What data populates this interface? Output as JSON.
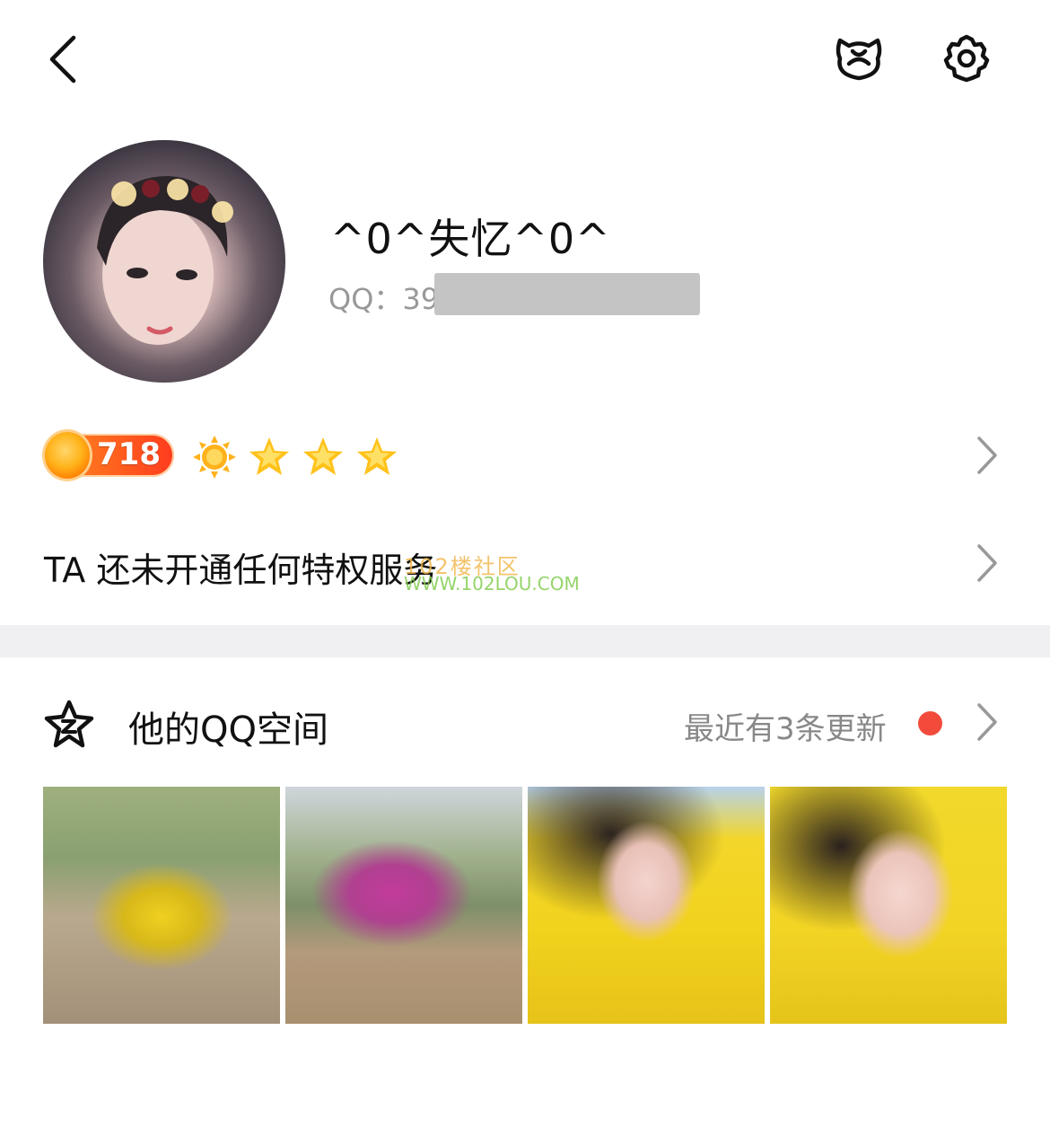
{
  "header": {
    "back_icon": "chevron-left-icon",
    "pet_icon": "pet-bear-icon",
    "settings_icon": "gear-icon"
  },
  "profile": {
    "nickname": "^0^失忆^0^",
    "qq_label": "QQ：",
    "qq_visible": "39"
  },
  "level": {
    "value": "718",
    "icons": [
      "sun-icon",
      "star-icon",
      "star-icon",
      "star-icon"
    ],
    "colors": {
      "badge_start": "#ff8f1f",
      "badge_end": "#ff3b1e",
      "star": "#ffc21a"
    }
  },
  "privilege": {
    "text": "TA 还未开通任何特权服务",
    "watermark_line1": "102楼社区",
    "watermark_line2": "WWW.102LOU.COM"
  },
  "qzone": {
    "title": "他的QQ空间",
    "update_text": "最近有3条更新",
    "dot_color": "#f24b3c",
    "photos": [
      "yellow flowering shrub",
      "purple flowering tree",
      "girl in rapeseed field",
      "girl with braid in rapeseed field"
    ]
  }
}
